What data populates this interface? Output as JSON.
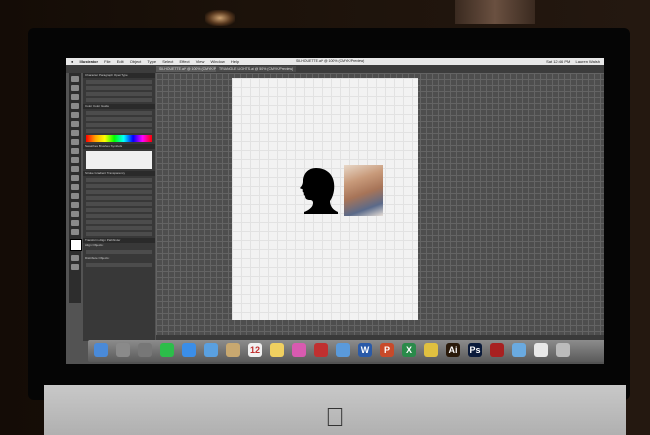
{
  "menubar": {
    "app_name": "Illustrator",
    "items": [
      "File",
      "Edit",
      "Object",
      "Type",
      "Select",
      "Effect",
      "View",
      "Window",
      "Help"
    ],
    "time": "Sat 12:46 PM",
    "user": "Lauren Walsh"
  },
  "tabs": [
    {
      "label": "SILHOUETTE.ai* @ 100% (CMYK/Preview)"
    },
    {
      "label": "TRIANGLE LIGHTS.ai @ 50% (CMYK/Preview)"
    }
  ],
  "window_title": "SILHOUETTE.ai* @ 100% (CMYK/Preview)",
  "panels": {
    "character_tabs": "Character  Paragraph  OpenType",
    "color_tabs": "Color  Color Guide",
    "brush_tabs": "Swatches  Brushes  Symbols",
    "stroke_tabs": "Stroke  Gradient  Transparency",
    "bottom_tabs": "Transform  Align  Pathfinder",
    "align_label": "Align Objects:",
    "distribute_label": "Distribute Objects:"
  },
  "dock": {
    "icons": [
      {
        "name": "finder-icon",
        "color": "#4a8ad8",
        "glyph": ""
      },
      {
        "name": "launchpad-icon",
        "color": "#8a8a8a",
        "glyph": ""
      },
      {
        "name": "system-preferences-icon",
        "color": "#777777",
        "glyph": ""
      },
      {
        "name": "spotify-icon",
        "color": "#2cbd4a",
        "glyph": ""
      },
      {
        "name": "safari-icon",
        "color": "#3b8ee8",
        "glyph": ""
      },
      {
        "name": "mail-icon",
        "color": "#5aa0e0",
        "glyph": ""
      },
      {
        "name": "contacts-icon",
        "color": "#c8a870",
        "glyph": ""
      },
      {
        "name": "calendar-icon",
        "color": "#f0f0f0",
        "glyph": "12"
      },
      {
        "name": "notes-icon",
        "color": "#f0d060",
        "glyph": ""
      },
      {
        "name": "itunes-icon",
        "color": "#d85ab0",
        "glyph": ""
      },
      {
        "name": "photo-booth-icon",
        "color": "#c03030",
        "glyph": ""
      },
      {
        "name": "iphoto-icon",
        "color": "#5a9adb",
        "glyph": ""
      },
      {
        "name": "word-icon",
        "color": "#2a5aa8",
        "glyph": "W"
      },
      {
        "name": "powerpoint-icon",
        "color": "#c84a2a",
        "glyph": "P"
      },
      {
        "name": "excel-icon",
        "color": "#2a8a4a",
        "glyph": "X"
      },
      {
        "name": "chrome-icon",
        "color": "#e0c040",
        "glyph": ""
      },
      {
        "name": "illustrator-icon",
        "color": "#2a1a0a",
        "glyph": "Ai"
      },
      {
        "name": "photoshop-icon",
        "color": "#0a1a3a",
        "glyph": "Ps"
      },
      {
        "name": "acrobat-icon",
        "color": "#a82020",
        "glyph": ""
      },
      {
        "name": "downloads-folder-icon",
        "color": "#6aaae0",
        "glyph": ""
      },
      {
        "name": "documents-icon",
        "color": "#e8e8e8",
        "glyph": ""
      },
      {
        "name": "trash-icon",
        "color": "#bbbbbb",
        "glyph": ""
      }
    ]
  },
  "colors": {
    "artboard": "#f2f2f2",
    "canvas": "#4e4e4e",
    "silhouette": "#000000"
  }
}
